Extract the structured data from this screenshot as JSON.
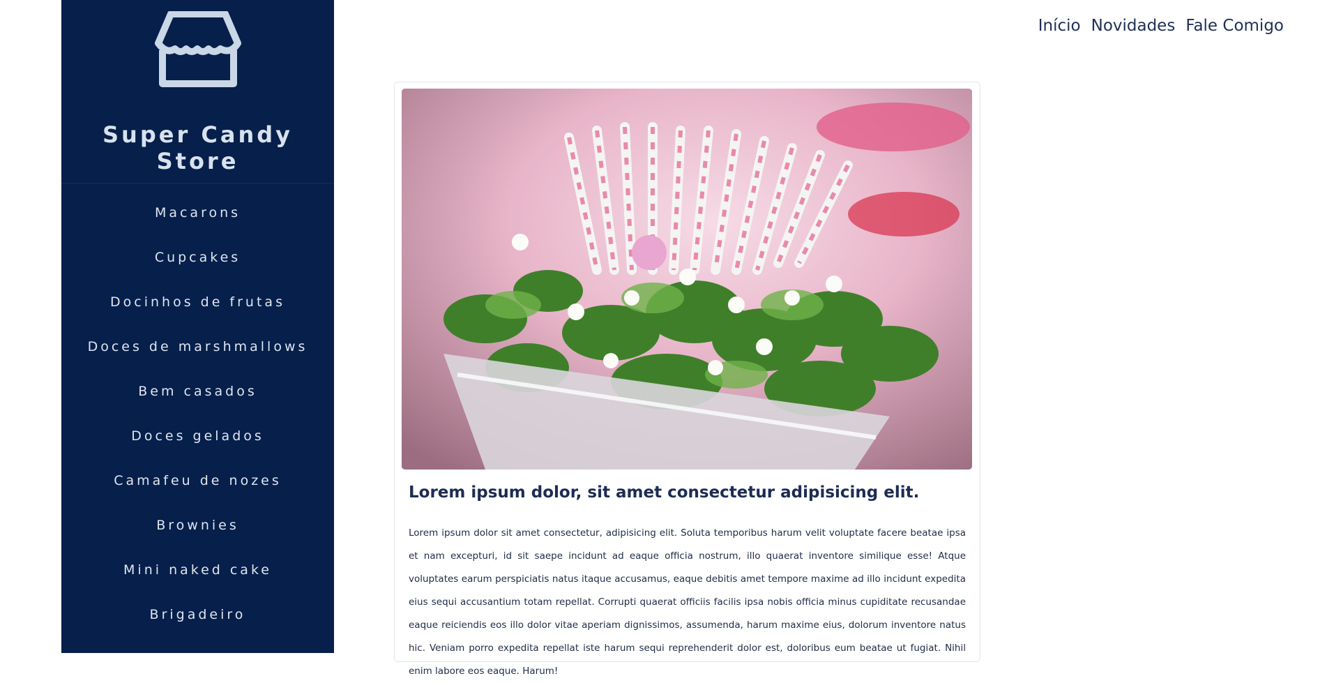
{
  "sidebar": {
    "brand_title": "Super Candy Store",
    "menu": [
      {
        "label": "Macarons"
      },
      {
        "label": "Cupcakes"
      },
      {
        "label": "Docinhos de frutas"
      },
      {
        "label": "Doces de marshmallows"
      },
      {
        "label": "Bem casados"
      },
      {
        "label": "Doces gelados"
      },
      {
        "label": "Camafeu de nozes"
      },
      {
        "label": "Brownies"
      },
      {
        "label": "Mini naked cake"
      },
      {
        "label": "Brigadeiro"
      }
    ]
  },
  "topnav": {
    "inicio": "Início",
    "novidades": "Novidades",
    "fale": "Fale Comigo"
  },
  "post": {
    "title": "Lorem ipsum dolor, sit amet consectetur adipisicing elit.",
    "body": "Lorem ipsum dolor sit amet consectetur, adipisicing elit. Soluta temporibus harum velit voluptate facere beatae ipsa et nam excepturi, id sit saepe incidunt ad eaque officia nostrum, illo quaerat inventore similique esse! Atque voluptates earum perspiciatis natus itaque accusamus, eaque debitis amet tempore maxime ad illo incidunt expedita eius sequi accusantium totam repellat. Corrupti quaerat officiis facilis ipsa nobis officia minus cupiditate recusandae eaque reiciendis eos illo dolor vitae aperiam dignissimos, assumenda, harum maxime eius, dolorum inventore natus hic. Veniam porro expedita repellat iste harum sequi reprehenderit dolor est, doloribus eum beatae ut fugiat. Nihil enim labore eos eaque. Harum!"
  },
  "colors": {
    "sidebar_bg": "#061f4b",
    "sidebar_text": "#dfe6ef",
    "icon_color": "#c9d7e6",
    "accent_text": "#1d2c52"
  },
  "icons": {
    "store": "store-icon"
  }
}
